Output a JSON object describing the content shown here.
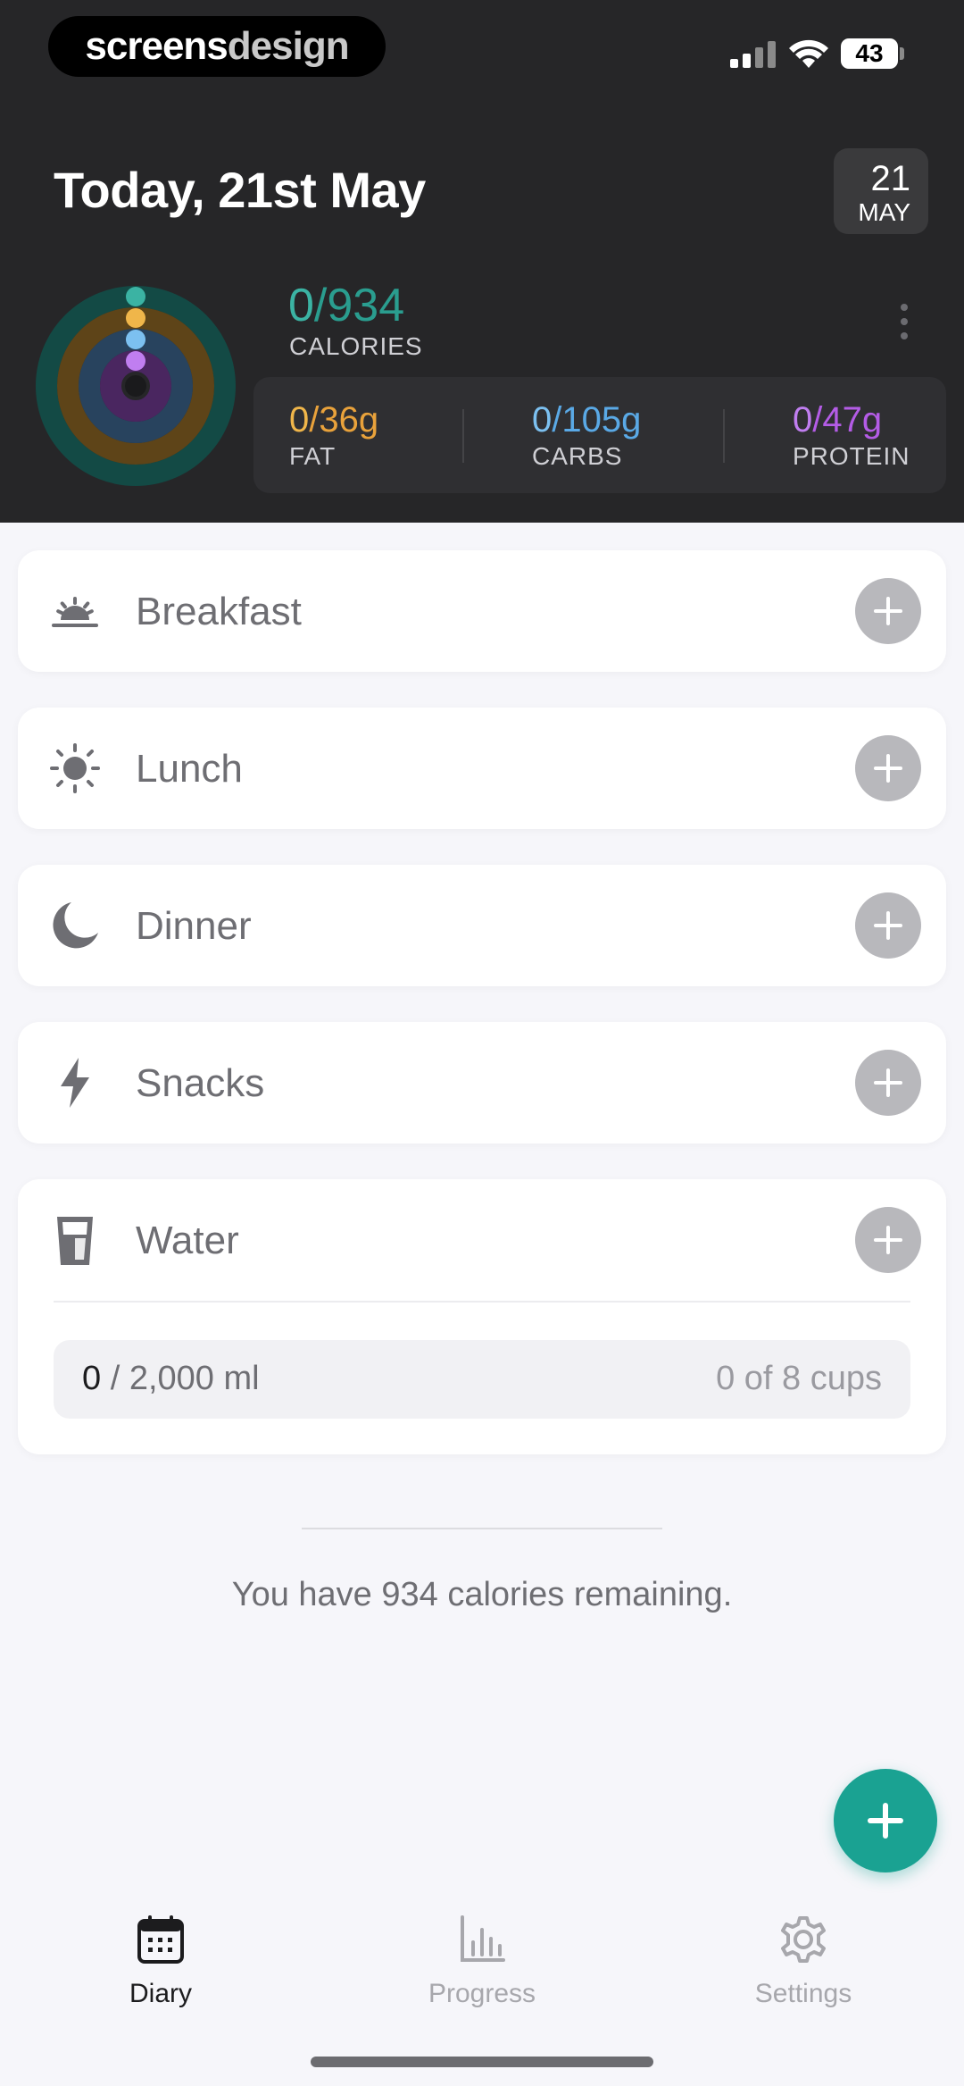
{
  "status_bar": {
    "brand_part1": "screens",
    "brand_part2": "design",
    "battery": "43"
  },
  "header": {
    "title": "Today, 21st May",
    "date_badge": {
      "day": "21",
      "month": "MAY"
    }
  },
  "summary": {
    "calories": {
      "current": "0",
      "goal": "/934",
      "label": "CALORIES",
      "color": "#2a9d8f"
    },
    "macros": [
      {
        "current": "0",
        "goal": "/36g",
        "label": "FAT",
        "color": "#e9a23b"
      },
      {
        "current": "0",
        "goal": "/105g",
        "label": "CARBS",
        "color": "#5aa9e6"
      },
      {
        "current": "0",
        "goal": "/47g",
        "label": "PROTEIN",
        "color": "#b45ce6"
      }
    ]
  },
  "meals": [
    {
      "label": "Breakfast",
      "icon": "sunrise-icon"
    },
    {
      "label": "Lunch",
      "icon": "sun-icon"
    },
    {
      "label": "Dinner",
      "icon": "moon-icon"
    },
    {
      "label": "Snacks",
      "icon": "lightning-icon"
    }
  ],
  "water": {
    "label": "Water",
    "icon": "glass-icon",
    "current": "0",
    "goal": " / 2,000 ml",
    "cups": "0 of 8 cups"
  },
  "remaining_text": "You have 934 calories remaining.",
  "tabs": [
    {
      "label": "Diary",
      "icon": "calendar-icon",
      "active": true
    },
    {
      "label": "Progress",
      "icon": "bar-chart-icon",
      "active": false
    },
    {
      "label": "Settings",
      "icon": "gear-icon",
      "active": false
    }
  ]
}
